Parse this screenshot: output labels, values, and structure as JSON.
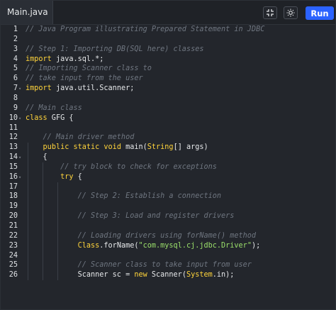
{
  "toolbar": {
    "tab_label": "Main.java",
    "run_label": "Run"
  },
  "editor": {
    "lines": [
      {
        "n": "1",
        "fold": false,
        "tokens": [
          {
            "t": "// Java Program illustrating Prepared Statement in JDBC",
            "c": "comment"
          }
        ]
      },
      {
        "n": "2",
        "fold": false,
        "tokens": []
      },
      {
        "n": "3",
        "fold": false,
        "tokens": [
          {
            "t": "// Step 1: Importing DB(SQL here) classes",
            "c": "comment"
          }
        ]
      },
      {
        "n": "4",
        "fold": false,
        "tokens": [
          {
            "t": "import",
            "c": "keyword"
          },
          {
            "t": " java.sql.*;",
            "c": "plain"
          }
        ]
      },
      {
        "n": "5",
        "fold": false,
        "tokens": [
          {
            "t": "// Importing Scanner class to",
            "c": "comment"
          }
        ]
      },
      {
        "n": "6",
        "fold": false,
        "tokens": [
          {
            "t": "// take input from the user",
            "c": "comment"
          }
        ]
      },
      {
        "n": "7",
        "fold": true,
        "tokens": [
          {
            "t": "import",
            "c": "keyword"
          },
          {
            "t": " java.util.Scanner;",
            "c": "plain"
          }
        ]
      },
      {
        "n": "8",
        "fold": false,
        "tokens": []
      },
      {
        "n": "9",
        "fold": false,
        "tokens": [
          {
            "t": "// Main class",
            "c": "comment"
          }
        ]
      },
      {
        "n": "10",
        "fold": true,
        "tokens": [
          {
            "t": "class",
            "c": "keyword"
          },
          {
            "t": " GFG {",
            "c": "plain"
          }
        ]
      },
      {
        "n": "11",
        "fold": false,
        "tokens": []
      },
      {
        "n": "12",
        "fold": false,
        "tokens": [
          {
            "t": "    // Main driver method",
            "c": "comment"
          }
        ]
      },
      {
        "n": "13",
        "fold": false,
        "tokens": [
          {
            "t": "    ",
            "c": "plain"
          },
          {
            "t": "public static void",
            "c": "keyword"
          },
          {
            "t": " main(",
            "c": "plain"
          },
          {
            "t": "String",
            "c": "class"
          },
          {
            "t": "[] args)",
            "c": "plain"
          }
        ]
      },
      {
        "n": "14",
        "fold": true,
        "tokens": [
          {
            "t": "    {",
            "c": "plain"
          }
        ]
      },
      {
        "n": "15",
        "fold": false,
        "tokens": [
          {
            "t": "        // try block to check for exceptions",
            "c": "comment"
          }
        ]
      },
      {
        "n": "16",
        "fold": true,
        "tokens": [
          {
            "t": "        ",
            "c": "plain"
          },
          {
            "t": "try",
            "c": "keyword"
          },
          {
            "t": " {",
            "c": "plain"
          }
        ]
      },
      {
        "n": "17",
        "fold": false,
        "tokens": []
      },
      {
        "n": "18",
        "fold": false,
        "tokens": [
          {
            "t": "            // Step 2: Establish a connection",
            "c": "comment"
          }
        ]
      },
      {
        "n": "19",
        "fold": false,
        "tokens": []
      },
      {
        "n": "20",
        "fold": false,
        "tokens": [
          {
            "t": "            // Step 3: Load and register drivers",
            "c": "comment"
          }
        ]
      },
      {
        "n": "21",
        "fold": false,
        "tokens": []
      },
      {
        "n": "22",
        "fold": false,
        "tokens": [
          {
            "t": "            // Loading drivers using forName() method",
            "c": "comment"
          }
        ]
      },
      {
        "n": "23",
        "fold": false,
        "tokens": [
          {
            "t": "            ",
            "c": "plain"
          },
          {
            "t": "Class",
            "c": "class"
          },
          {
            "t": ".forName(",
            "c": "plain"
          },
          {
            "t": "\"com.mysql.cj.jdbc.Driver\"",
            "c": "string"
          },
          {
            "t": ");",
            "c": "plain"
          }
        ]
      },
      {
        "n": "24",
        "fold": false,
        "tokens": []
      },
      {
        "n": "25",
        "fold": false,
        "tokens": [
          {
            "t": "            // Scanner class to take input from user",
            "c": "comment"
          }
        ]
      },
      {
        "n": "26",
        "fold": false,
        "tokens": [
          {
            "t": "            Scanner sc = ",
            "c": "plain"
          },
          {
            "t": "new",
            "c": "keyword"
          },
          {
            "t": " Scanner(",
            "c": "plain"
          },
          {
            "t": "System",
            "c": "class"
          },
          {
            "t": ".in);",
            "c": "plain"
          }
        ]
      }
    ]
  },
  "icons": {
    "collapse": "collapse-arrows-icon",
    "theme": "sun-icon"
  },
  "colors": {
    "run_button": "#2b63ff",
    "keyword": "#ffd43b",
    "string": "#9be06b",
    "comment": "#6f7680"
  }
}
